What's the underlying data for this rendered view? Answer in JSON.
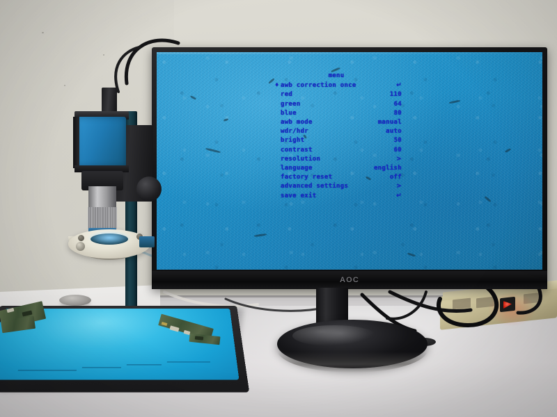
{
  "scene": {
    "title": "Industrial microscope camera OSD menu on AOC monitor",
    "wall_color": "#d8d6ce",
    "desk_color": "#d5d3d4"
  },
  "monitor": {
    "brand": "AOC",
    "bezel_color": "#121214",
    "screen_background_color": "#1d8ec6"
  },
  "osd": {
    "title": "menu",
    "text_color": "#1726c8",
    "cursor_glyph": "♦",
    "selected_index": 0,
    "items": [
      {
        "label": "awb correction once",
        "value": "↵",
        "selected": true
      },
      {
        "label": "red",
        "value": "110",
        "selected": false
      },
      {
        "label": "green",
        "value": "64",
        "selected": false
      },
      {
        "label": "blue",
        "value": "80",
        "selected": false
      },
      {
        "label": "awb mode",
        "value": "manual",
        "selected": false
      },
      {
        "label": "wdr/hdr",
        "value": "auto",
        "selected": false
      },
      {
        "label": "bright",
        "value": "50",
        "selected": false
      },
      {
        "label": "contrast",
        "value": "60",
        "selected": false
      },
      {
        "label": "resolution",
        "value": ">",
        "selected": false
      },
      {
        "label": "language",
        "value": "english",
        "selected": false
      },
      {
        "label": "factory reset",
        "value": "off",
        "selected": false
      },
      {
        "label": "advanced settings",
        "value": ">",
        "selected": false
      },
      {
        "label": "save exit",
        "value": "↵",
        "selected": false
      }
    ]
  },
  "microscope": {
    "camera_body_color": "#1f7ab3",
    "pole_color": "#123540",
    "ring_light_color": "#e3e0d2"
  },
  "mat": {
    "surface_color": "#2fb7e3",
    "frame_color": "#232325"
  },
  "power_strip": {
    "body_color": "#c2b890",
    "switch_state_color": "#d41a08"
  }
}
